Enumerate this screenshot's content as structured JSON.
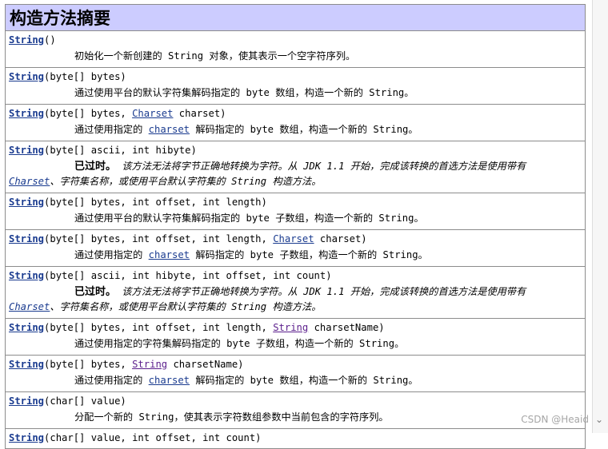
{
  "header": {
    "title": "构造方法摘要"
  },
  "rows": [
    {
      "sig": [
        [
          "n",
          "String"
        ],
        [
          "t",
          "()"
        ]
      ],
      "desc": [
        [
          "t",
          "初始化一个新创建的 String 对象，使其表示一个空字符序列。"
        ]
      ]
    },
    {
      "sig": [
        [
          "n",
          "String"
        ],
        [
          "t",
          "(byte[] bytes)"
        ]
      ],
      "desc": [
        [
          "t",
          "通过使用平台的默认字符集解码指定的 byte 数组，构造一个新的 String。"
        ]
      ]
    },
    {
      "sig": [
        [
          "n",
          "String"
        ],
        [
          "t",
          "(byte[] bytes, "
        ],
        [
          "l",
          "Charset"
        ],
        [
          "t",
          " charset)"
        ]
      ],
      "desc": [
        [
          "t",
          "通过使用指定的 "
        ],
        [
          "l",
          "charset"
        ],
        [
          "t",
          " 解码指定的 byte 数组，构造一个新的 String。"
        ]
      ]
    },
    {
      "sig": [
        [
          "n",
          "String"
        ],
        [
          "t",
          "(byte[] ascii, int hibyte)"
        ]
      ],
      "dep": "已过时。",
      "desc": [
        [
          "i",
          " 该方法无法将字节正确地转换为字符。从 JDK 1.1 开始，完成该转换的首选方法是使用带有 "
        ],
        [
          "l",
          "Charset"
        ],
        [
          "i",
          "、字符集名称，或使用平台默认字符集的 String 构造方法。"
        ]
      ]
    },
    {
      "sig": [
        [
          "n",
          "String"
        ],
        [
          "t",
          "(byte[] bytes, int offset, int length)"
        ]
      ],
      "desc": [
        [
          "t",
          "通过使用平台的默认字符集解码指定的 byte 子数组，构造一个新的 String。"
        ]
      ]
    },
    {
      "sig": [
        [
          "n",
          "String"
        ],
        [
          "t",
          "(byte[] bytes, int offset, int length, "
        ],
        [
          "l",
          "Charset"
        ],
        [
          "t",
          " charset)"
        ]
      ],
      "desc": [
        [
          "t",
          "通过使用指定的 "
        ],
        [
          "l",
          "charset"
        ],
        [
          "t",
          " 解码指定的 byte 子数组，构造一个新的 String。"
        ]
      ]
    },
    {
      "sig": [
        [
          "n",
          "String"
        ],
        [
          "t",
          "(byte[] ascii, int hibyte, int offset, int count)"
        ]
      ],
      "dep": "已过时。",
      "desc": [
        [
          "i",
          " 该方法无法将字节正确地转换为字符。从 JDK 1.1 开始，完成该转换的首选方法是使用带有 "
        ],
        [
          "l",
          "Charset"
        ],
        [
          "i",
          "、字符集名称，或使用平台默认字符集的 String 构造方法。"
        ]
      ]
    },
    {
      "sig": [
        [
          "n",
          "String"
        ],
        [
          "t",
          "(byte[] bytes, int offset, int length, "
        ],
        [
          "v",
          "String"
        ],
        [
          "t",
          " charsetName)"
        ]
      ],
      "desc": [
        [
          "t",
          "通过使用指定的字符集解码指定的 byte 子数组，构造一个新的 String。"
        ]
      ]
    },
    {
      "sig": [
        [
          "n",
          "String"
        ],
        [
          "t",
          "(byte[] bytes, "
        ],
        [
          "v",
          "String"
        ],
        [
          "t",
          " charsetName)"
        ]
      ],
      "desc": [
        [
          "t",
          "通过使用指定的 "
        ],
        [
          "l",
          "charset"
        ],
        [
          "t",
          " 解码指定的 byte 数组，构造一个新的 String。"
        ]
      ]
    },
    {
      "sig": [
        [
          "n",
          "String"
        ],
        [
          "t",
          "(char[] value)"
        ]
      ],
      "desc": [
        [
          "t",
          "分配一个新的 String，使其表示字符数组参数中当前包含的字符序列。"
        ]
      ]
    },
    {
      "sig": [
        [
          "n",
          "String"
        ],
        [
          "t",
          "(char[] value, int offset, int count)"
        ]
      ],
      "desc": []
    }
  ],
  "watermark": "CSDN @Heaid",
  "colors": {
    "header_bg": "#ccccff",
    "link": "#1a3b8f",
    "visited_link": "#5b1e8c",
    "border": "#8c8c8c"
  }
}
